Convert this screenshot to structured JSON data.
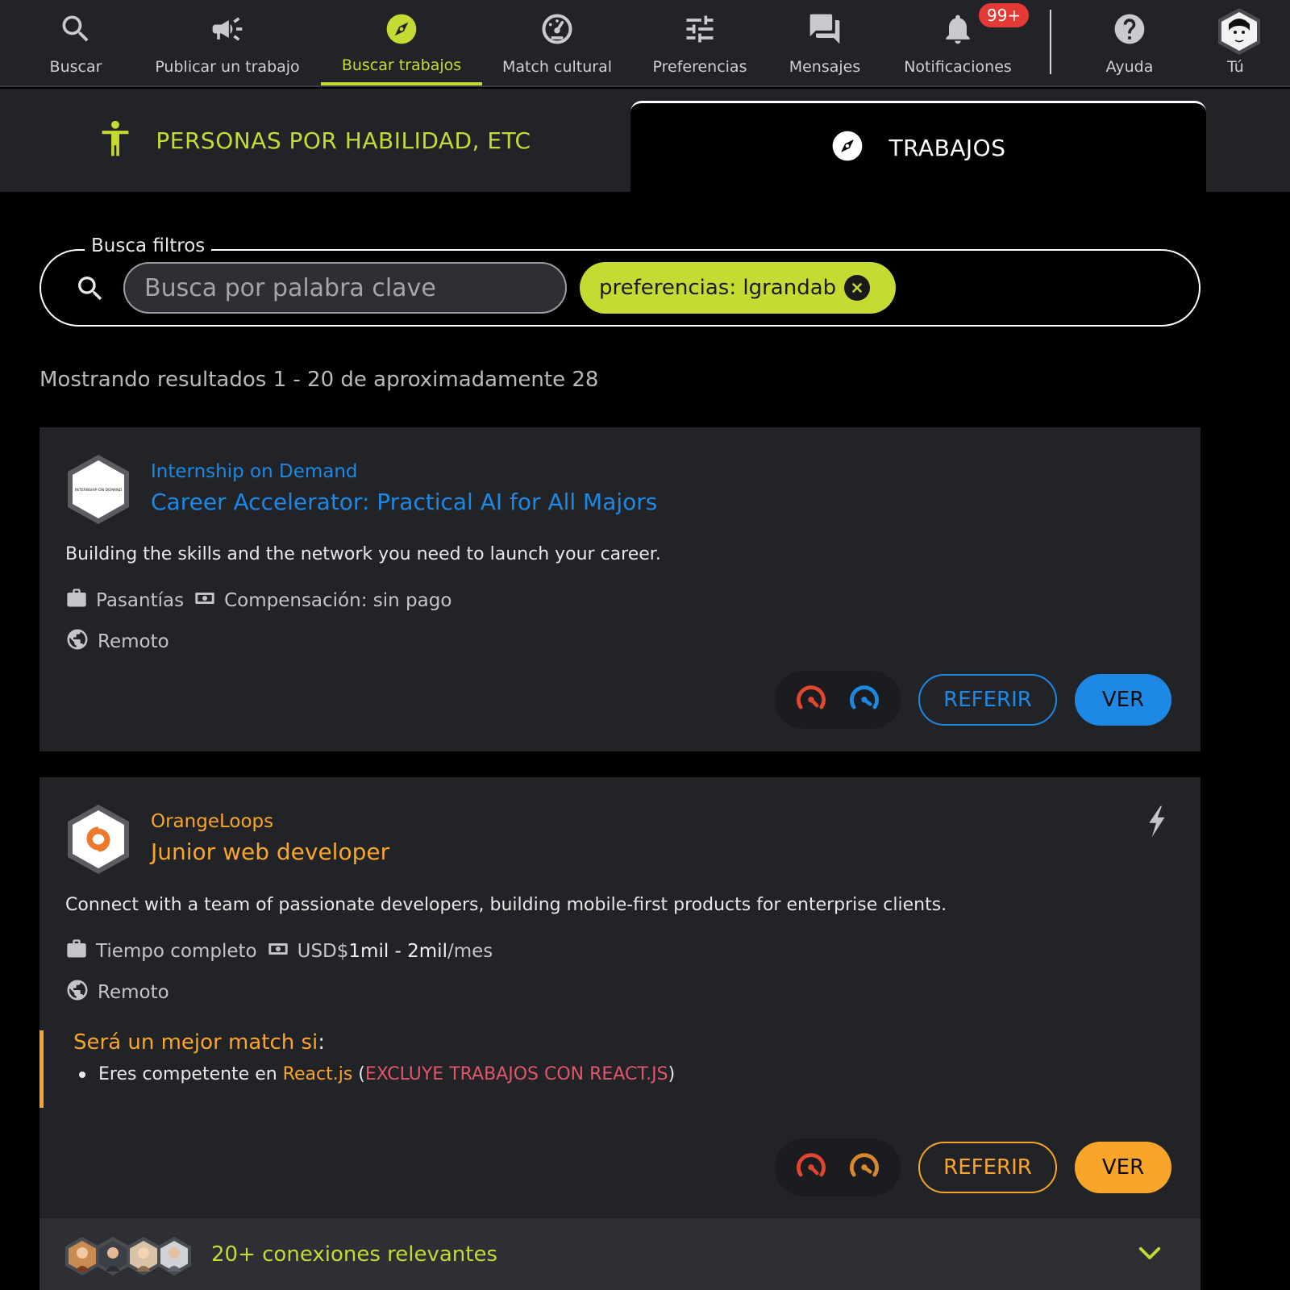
{
  "nav": {
    "items": [
      {
        "label": "Buscar",
        "icon": "search-icon"
      },
      {
        "label": "Publicar un trabajo",
        "icon": "megaphone-icon"
      },
      {
        "label": "Buscar trabajos",
        "icon": "compass-icon",
        "active": true
      },
      {
        "label": "Match cultural",
        "icon": "gauge-icon"
      },
      {
        "label": "Preferencias",
        "icon": "sliders-icon"
      },
      {
        "label": "Mensajes",
        "icon": "chat-icon"
      },
      {
        "label": "Notificaciones",
        "icon": "bell-icon"
      },
      {
        "label": "Ayuda",
        "icon": "help-icon"
      },
      {
        "label": "Tú",
        "icon": "avatar"
      }
    ],
    "notifications_badge": "99+"
  },
  "tabs": {
    "people": "PERSONAS POR HABILIDAD, ETC",
    "jobs": "TRABAJOS"
  },
  "search": {
    "legend": "Busca filtros",
    "placeholder": "Busca por palabra clave",
    "chip": "preferencias: lgrandab"
  },
  "results_text": "Mostrando resultados 1 - 20 de aproximadamente 28",
  "cards": [
    {
      "company": "Internship on Demand",
      "logo_text": "INTERNSHIP ON DEMAND",
      "title": "Career Accelerator: Practical AI for All Majors",
      "description": "Building the skills and the network you need to launch your career.",
      "type": "Pasantías",
      "compensation": "Compensación: sin pago",
      "location": "Remoto",
      "refer_label": "REFERIR",
      "view_label": "VER",
      "accent": "#1e88e5"
    },
    {
      "company": "OrangeLoops",
      "title": "Junior web developer",
      "description": "Connect with a team of passionate developers, building mobile-first products for enterprise clients.",
      "type": "Tiempo completo",
      "salary_prefix": "USD$",
      "salary_range": "1mil - 2mil",
      "salary_suffix": "/mes",
      "location": "Remoto",
      "match_title": "Será un mejor match si",
      "match_colon": ":",
      "match_item_prefix": "Eres competente en ",
      "match_skill": "React.js",
      "match_open": " (",
      "match_exclude": "EXCLUYE TRABAJOS CON REACT.JS",
      "match_close": ")",
      "refer_label": "REFERIR",
      "view_label": "VER",
      "accent": "#f9a52a"
    }
  ],
  "connections_label": "20+ conexiones relevantes",
  "colors": {
    "lime": "#c6da34",
    "blue": "#1e88e5",
    "orange": "#f9a52a",
    "red": "#e53935",
    "pink": "#e0566b",
    "panel": "#222327"
  }
}
